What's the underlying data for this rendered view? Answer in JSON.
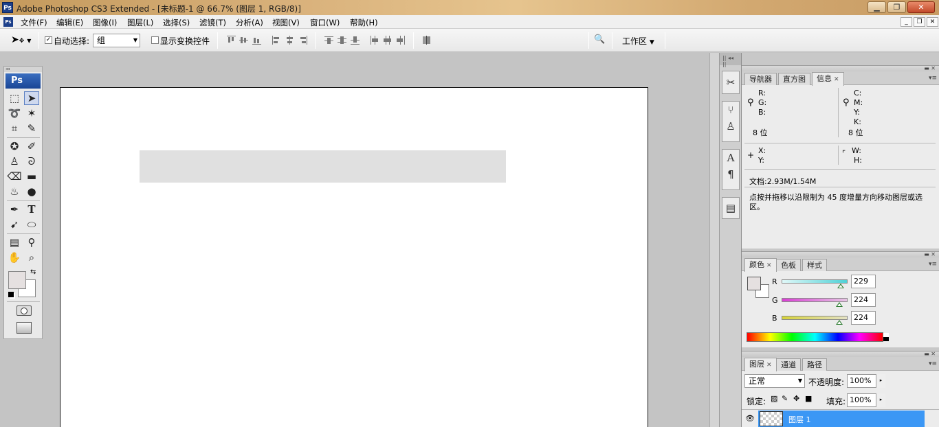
{
  "window": {
    "app_logo": "Ps",
    "title": "Adobe Photoshop CS3 Extended - [未标题-1 @ 66.7% (图层 1, RGB/8)]",
    "minimize": "▁",
    "restore": "❐",
    "close": "✕"
  },
  "menu": {
    "logo": "Ps",
    "items": [
      "文件(F)",
      "编辑(E)",
      "图像(I)",
      "图层(L)",
      "选择(S)",
      "滤镜(T)",
      "分析(A)",
      "视图(V)",
      "窗口(W)",
      "帮助(H)"
    ],
    "doc_min": "_",
    "doc_restore": "❐",
    "doc_close": "✕"
  },
  "options": {
    "auto_select_checked": "✓",
    "auto_select_label": "自动选择:",
    "auto_select_value": "组",
    "show_transform_label": "显示变换控件",
    "workspace_label": "工作区"
  },
  "toolbox": {
    "logo": "Ps"
  },
  "info_panel": {
    "tabs": [
      "导航器",
      "直方图",
      "信息"
    ],
    "r_label": "R:",
    "g_label": "G:",
    "b_label": "B:",
    "c_label": "C:",
    "m_label": "M:",
    "y_label": "Y:",
    "k_label": "K:",
    "bits_left": "8 位",
    "bits_right": "8 位",
    "x_label": "X:",
    "y2_label": "Y:",
    "w_label": "W:",
    "h_label": "H:",
    "doc_size": "文档:2.93M/1.54M",
    "hint": "点按并拖移以沿限制为 45 度增量方向移动图层或选区。"
  },
  "color_panel": {
    "tabs": [
      "颜色",
      "色板",
      "样式"
    ],
    "channels": [
      {
        "label": "R",
        "value": "229",
        "color": "#4fd1d6"
      },
      {
        "label": "G",
        "value": "224",
        "color": "#d64fd1"
      },
      {
        "label": "B",
        "value": "224",
        "color": "#d6d14f"
      }
    ],
    "foreground": "#e5e0e0",
    "levels": {
      "r": 229,
      "g": 224,
      "b": 224
    }
  },
  "layers_panel": {
    "tabs": [
      "图层",
      "通道",
      "路径"
    ],
    "blend_mode": "正常",
    "opacity_label": "不透明度:",
    "opacity_value": "100%",
    "lock_label": "锁定:",
    "fill_label": "填充:",
    "fill_value": "100%",
    "layer_name": "图层 1"
  },
  "document": {
    "rect_color": "#e0e0e0"
  }
}
